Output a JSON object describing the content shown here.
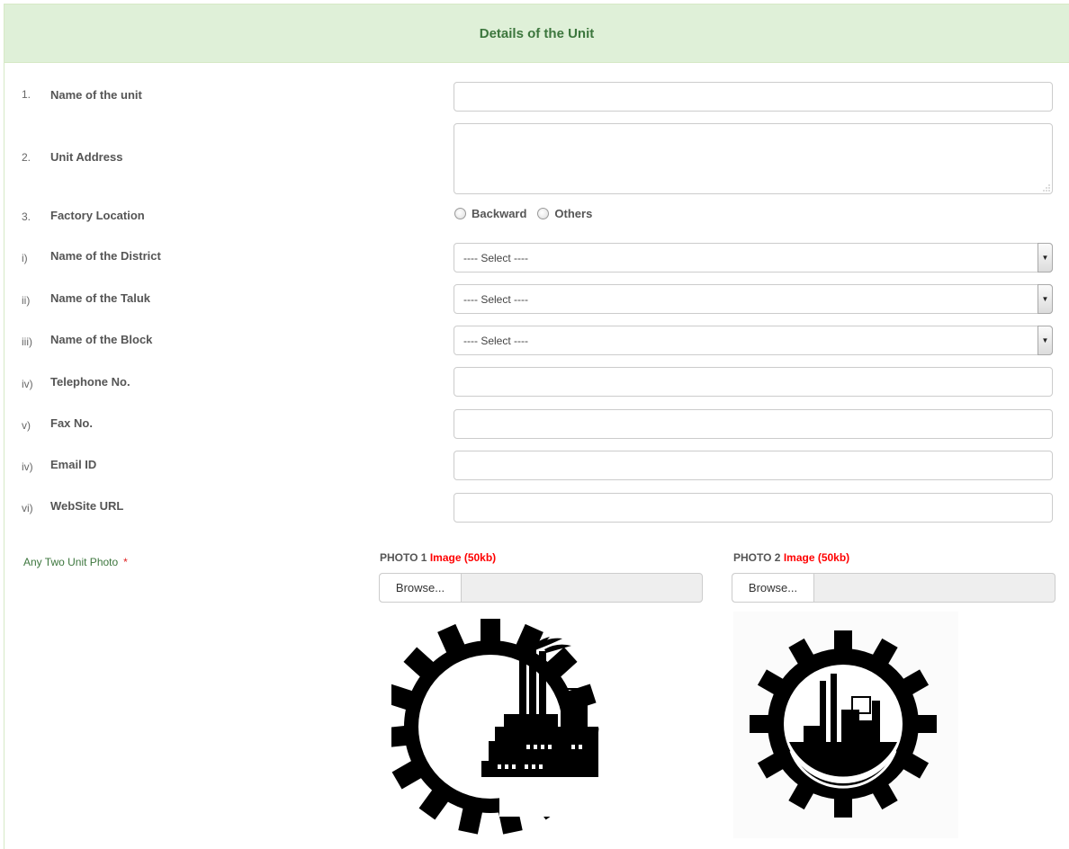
{
  "heading": {
    "title": "Details of the Unit"
  },
  "fields": [
    {
      "num": "1.",
      "label": "Name of the unit",
      "type": "text",
      "value": ""
    },
    {
      "num": "2.",
      "label": "Unit Address",
      "type": "textarea",
      "value": ""
    },
    {
      "num": "3.",
      "label": "Factory Location",
      "type": "radio",
      "options": [
        "Backward",
        "Others"
      ]
    },
    {
      "num": "i)",
      "label": "Name of the District",
      "type": "select",
      "selected": "---- Select ----"
    },
    {
      "num": "ii)",
      "label": "Name of the Taluk",
      "type": "select",
      "selected": "---- Select ----"
    },
    {
      "num": "iii)",
      "label": "Name of the Block",
      "type": "select",
      "selected": "---- Select ----"
    },
    {
      "num": "iv)",
      "label": "Telephone No.",
      "type": "text",
      "value": ""
    },
    {
      "num": "v)",
      "label": "Fax No.",
      "type": "text",
      "value": ""
    },
    {
      "num": "iv)",
      "label": "Email ID",
      "type": "text",
      "value": ""
    },
    {
      "num": "vi)",
      "label": "WebSite URL",
      "type": "text",
      "value": ""
    }
  ],
  "photos": {
    "label": "Any Two Unit Photo",
    "required_mark": "*",
    "items": [
      {
        "title": "PHOTO 1",
        "hint": "Image (50kb)",
        "browse_label": "Browse...",
        "image": "gear-factory-logo"
      },
      {
        "title": "PHOTO 2",
        "hint": "Image (50kb)",
        "browse_label": "Browse...",
        "image": "gear-factory-logo"
      }
    ]
  },
  "colors": {
    "heading_bg": "#dff0d8",
    "heading_text": "#3c763d",
    "required": "#ff0000"
  }
}
